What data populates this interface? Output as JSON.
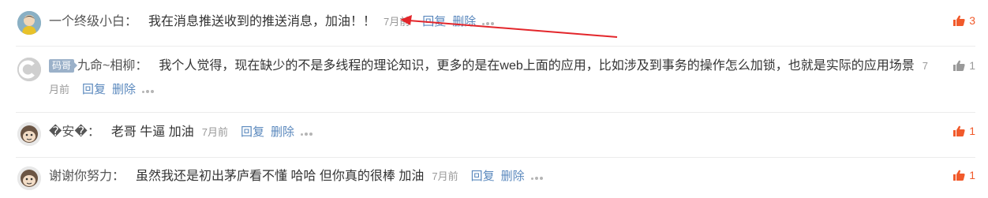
{
  "comments": [
    {
      "username": "一个终级小白",
      "content": "我在消息推送收到的推送消息，加油！！",
      "time": "7月前",
      "reply": "回复",
      "delete": "删除",
      "likes": "3",
      "liked": true
    },
    {
      "badge": "码哥",
      "username": "九命~相柳",
      "content": "我个人觉得，现在缺少的不是多线程的理论知识，更多的是在web上面的应用，比如涉及到事务的操作怎么加锁，也就是实际的应用场景",
      "time": "7月前",
      "reply": "回复",
      "delete": "删除",
      "likes": "1",
      "liked": false
    },
    {
      "username": "�安�",
      "content": "老哥 牛逼 加油",
      "time": "7月前",
      "reply": "回复",
      "delete": "删除",
      "likes": "1",
      "liked": true
    },
    {
      "username": "谢谢你努力",
      "content": "虽然我还是初出茅庐看不懂 哈哈 但你真的很棒 加油",
      "time": "7月前",
      "reply": "回复",
      "delete": "删除",
      "likes": "1",
      "liked": true
    }
  ],
  "colors": {
    "action_link": "#5a88bd",
    "like_active": "#f15a2b",
    "like_inactive": "#9a9a9a",
    "annotation_arrow": "#e3262b"
  },
  "icons": [
    "avatar",
    "thumbs-up-icon",
    "more-dots-icon",
    "arrow-annotation"
  ]
}
